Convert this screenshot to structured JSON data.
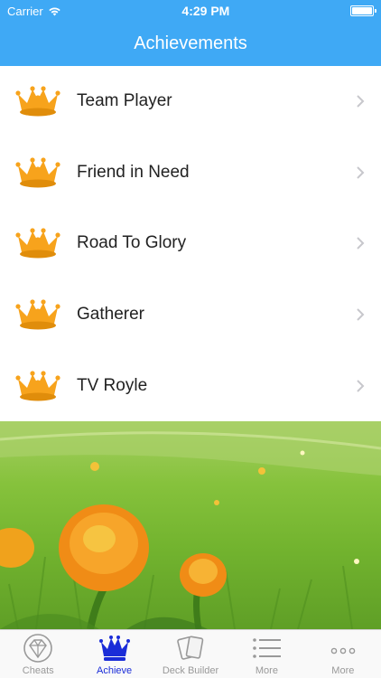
{
  "status_bar": {
    "carrier": "Carrier",
    "time": "4:29 PM"
  },
  "nav": {
    "title": "Achievements"
  },
  "achievements": [
    {
      "label": "Team Player",
      "icon": "crown-icon"
    },
    {
      "label": "Friend in Need",
      "icon": "crown-icon"
    },
    {
      "label": "Road To Glory",
      "icon": "crown-icon"
    },
    {
      "label": "Gatherer",
      "icon": "crown-icon"
    },
    {
      "label": "TV Royle",
      "icon": "crown-icon"
    }
  ],
  "tabbar": {
    "tabs": [
      {
        "label": "Cheats",
        "icon": "gem-icon"
      },
      {
        "label": "Achieve",
        "icon": "crown-icon",
        "active": true
      },
      {
        "label": "Deck Builder",
        "icon": "cards-icon"
      },
      {
        "label": "More",
        "icon": "list-icon"
      },
      {
        "label": "More",
        "icon": "more-dots-icon"
      }
    ]
  },
  "colors": {
    "nav_bg": "#3fa9f5",
    "crown": "#f7a31c",
    "active_tab": "#1a2cd8",
    "inactive_tab": "#999999"
  }
}
